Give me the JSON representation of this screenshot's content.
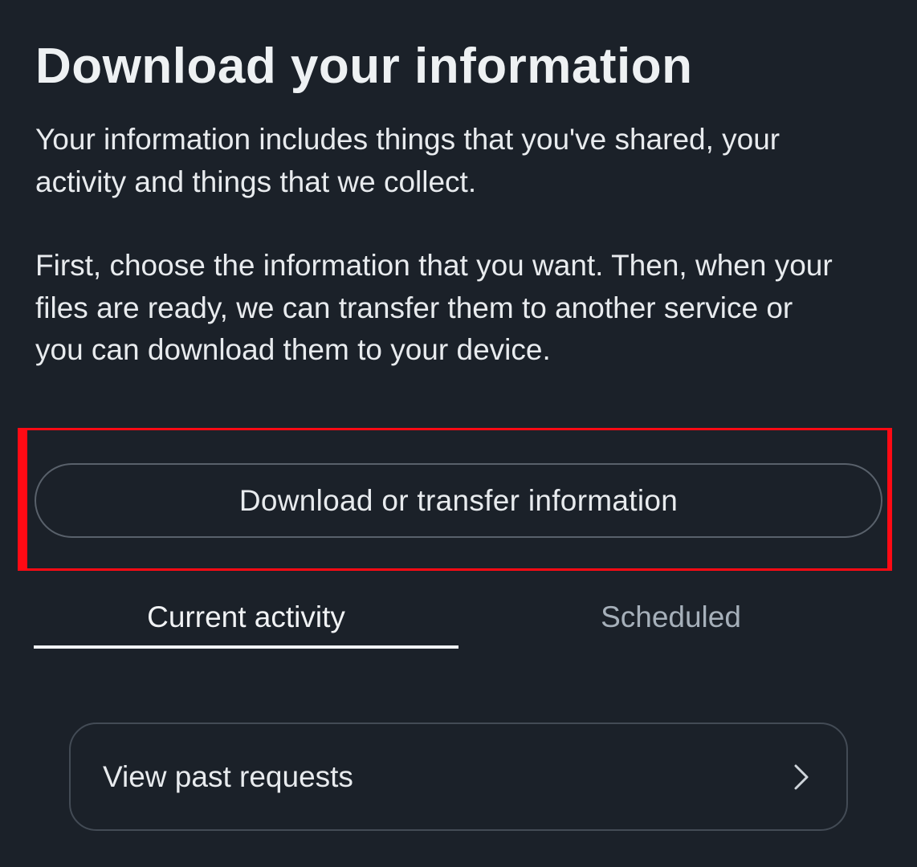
{
  "header": {
    "title": "Download your information"
  },
  "description": {
    "paragraph_1": "Your information includes things that you've shared, your activity and things that we collect.",
    "paragraph_2": "First, choose the information that you want. Then, when your files are ready, we can transfer them to another service or you can download them to your device."
  },
  "primary_action": {
    "label": "Download or transfer information"
  },
  "tabs": [
    {
      "label": "Current activity",
      "selected": true
    },
    {
      "label": "Scheduled",
      "selected": false
    }
  ],
  "past_requests": {
    "label": "View past requests",
    "icon": "chevron-right-icon"
  },
  "colors": {
    "background": "#1b2129",
    "text_primary": "#e8ebee",
    "text_inactive_tab": "#a6b0ba",
    "button_border": "#59616b",
    "highlight_box": "#ff0a14"
  }
}
